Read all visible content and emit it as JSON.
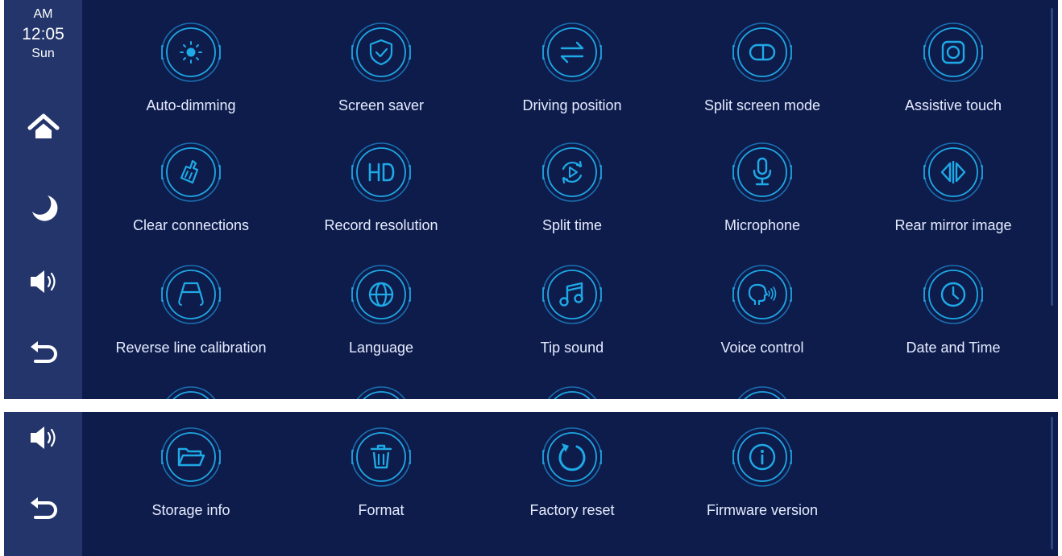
{
  "colors": {
    "background": "#0e1c4c",
    "sidebar": "#23356b",
    "accent": "#1fa9e6",
    "label": "#e6ecff"
  },
  "status": {
    "ampm": "AM",
    "time": "12:05",
    "day": "Sun"
  },
  "sidebar_top": [
    {
      "name": "home",
      "icon": "home-icon"
    },
    {
      "name": "night-mode",
      "icon": "moon-icon"
    },
    {
      "name": "volume",
      "icon": "speaker-icon"
    },
    {
      "name": "back",
      "icon": "back-arrow-icon"
    }
  ],
  "sidebar_bottom": [
    {
      "name": "volume",
      "icon": "speaker-icon"
    },
    {
      "name": "back",
      "icon": "back-arrow-icon"
    }
  ],
  "settings": [
    {
      "label": "Auto-dimming",
      "icon": "sun-icon"
    },
    {
      "label": "Screen saver",
      "icon": "shield-check-icon"
    },
    {
      "label": "Driving position",
      "icon": "swap-arrows-icon"
    },
    {
      "label": "Split screen mode",
      "icon": "split-screen-icon"
    },
    {
      "label": "Assistive touch",
      "icon": "assistive-touch-icon"
    },
    {
      "label": "Clear connections",
      "icon": "broom-icon"
    },
    {
      "label": "Record resolution",
      "icon": "hd-icon"
    },
    {
      "label": "Split time",
      "icon": "loop-play-icon"
    },
    {
      "label": "Microphone",
      "icon": "microphone-icon"
    },
    {
      "label": "Rear mirror image",
      "icon": "mirror-icon"
    },
    {
      "label": "Reverse line calibration",
      "icon": "reverse-lines-icon"
    },
    {
      "label": "Language",
      "icon": "globe-icon"
    },
    {
      "label": "Tip sound",
      "icon": "music-note-icon"
    },
    {
      "label": "Voice control",
      "icon": "voice-control-icon"
    },
    {
      "label": "Date and Time",
      "icon": "clock-icon"
    }
  ],
  "settings_page2": [
    {
      "label": "Storage info",
      "icon": "folder-icon"
    },
    {
      "label": "Format",
      "icon": "trash-icon"
    },
    {
      "label": "Factory reset",
      "icon": "reset-icon"
    },
    {
      "label": "Firmware version",
      "icon": "info-icon"
    }
  ]
}
